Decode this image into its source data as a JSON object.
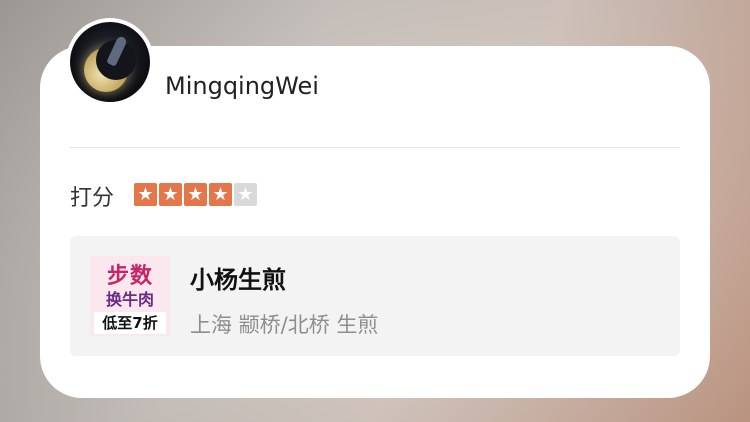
{
  "user": {
    "name": "MingqingWei",
    "avatar_icon": "crescent-moon-avatar"
  },
  "rating": {
    "label": "打分",
    "value": 4,
    "max": 5,
    "active_color": "#e4774a",
    "inactive_color": "#d9d9d9"
  },
  "shop": {
    "thumbnail": {
      "line1": "步数",
      "line2": "换牛肉",
      "line3": "低至7折"
    },
    "name": "小杨生煎",
    "meta": "上海 颛桥/北桥 生煎"
  }
}
